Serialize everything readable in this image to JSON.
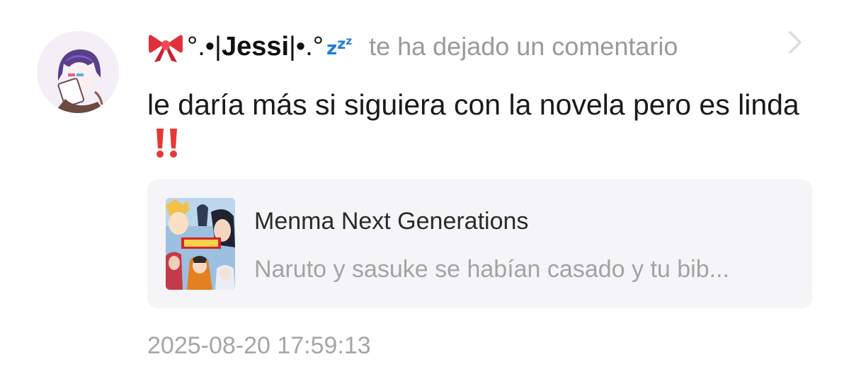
{
  "notification": {
    "avatar_icon": "user-avatar-anime-character",
    "user": {
      "prefix_icon": "ribbon-bow-icon",
      "decoration_left": "°.•|",
      "name": "Jessi",
      "decoration_right": "|•.°",
      "suffix_icon": "zzz-sleeping-icon"
    },
    "action_text": "te ha dejado un comentario",
    "chevron_icon": "chevron-right-icon",
    "comment_text": "le daría más si siguiera con la novela pero es linda",
    "comment_suffix_icon": "double-exclamation-icon",
    "story_card": {
      "cover_icon": "story-cover-image",
      "title": "Menma Next Generations",
      "description": "Naruto y sasuke se habían casado y tu bib..."
    },
    "timestamp": "2025-08-20 17:59:13"
  },
  "colors": {
    "ribbon": "#e0303c",
    "zzz": "#1f7de0",
    "exclamation": "#e53935",
    "card_background": "#f5f5f7",
    "secondary_text": "#9a9a9a"
  }
}
